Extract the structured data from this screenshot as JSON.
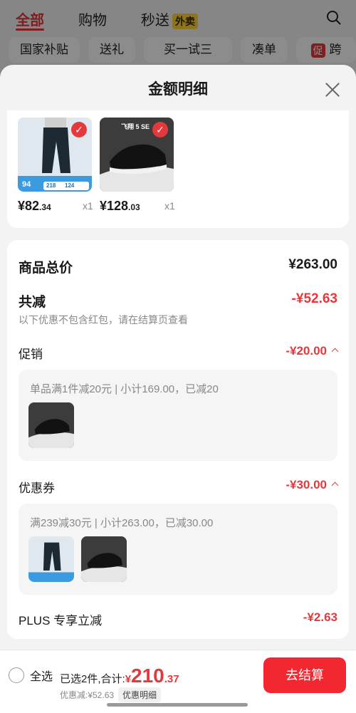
{
  "top_tabs": {
    "all": "全部",
    "shopping": "购物",
    "flash": "秒送",
    "takeout": "外卖"
  },
  "chips": [
    "国家补贴",
    "送礼",
    "买一试三",
    "凑单",
    "跨"
  ],
  "chip_promo_badge": "促",
  "sheet": {
    "title": "金额明细"
  },
  "items": [
    {
      "price_int": "¥82",
      "price_dec": ".34",
      "qty": "x1",
      "tag_price": "94",
      "tag_a": "218",
      "tag_b": "124"
    },
    {
      "price_int": "¥128",
      "price_dec": ".03",
      "qty": "x1",
      "brand": "飞翔 5 SE"
    }
  ],
  "breakdown": {
    "total_label": "商品总价",
    "total_value": "¥263.00",
    "discount_label": "共减",
    "discount_value": "-¥52.63",
    "discount_note": "以下优惠不包含红包，请在结算页查看",
    "promo_label": "促销",
    "promo_value": "-¥20.00",
    "promo_detail": "单品满1件减20元 | 小计169.00，已减20",
    "coupon_label": "优惠券",
    "coupon_value": "-¥30.00",
    "coupon_detail": "满239减30元 | 小计263.00，已减30.00",
    "plus_label": "PLUS 专享立减",
    "plus_value": "-¥2.63"
  },
  "bottom": {
    "select_all": "全选",
    "selected_text": "已选2件,合计:",
    "currency": "¥",
    "total_int": "210",
    "total_dec": ".37",
    "discount_text": "优惠减:¥52.63",
    "detail_button": "优惠明细",
    "checkout": "去结算"
  },
  "colors": {
    "accent": "#e4393c",
    "checkout": "#f2272f"
  }
}
